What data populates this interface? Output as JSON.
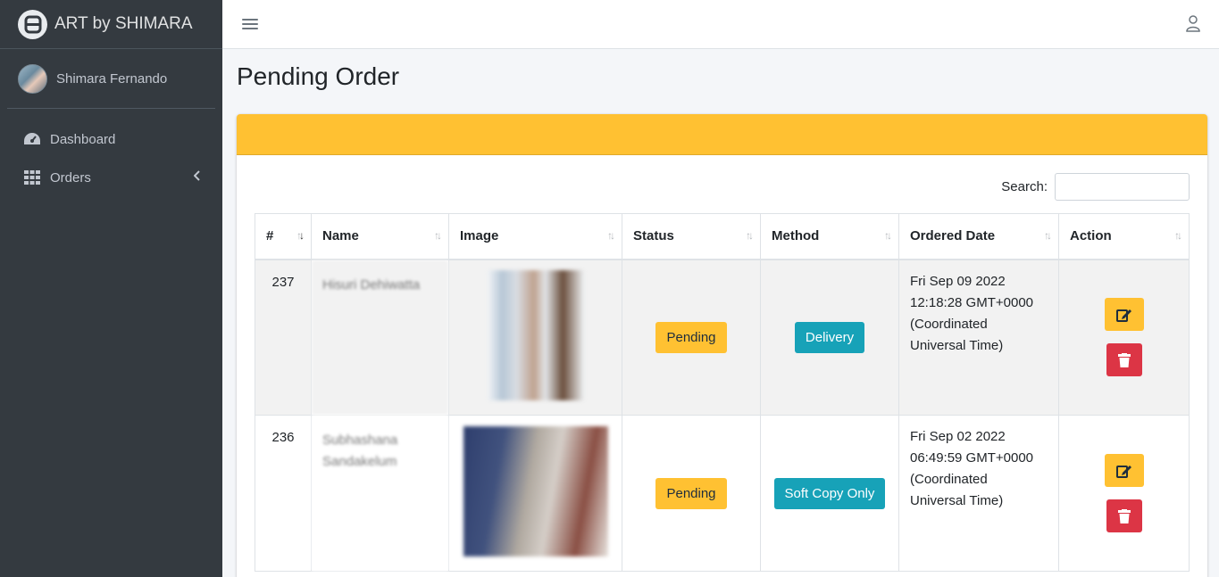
{
  "brand": {
    "name": "ART by SHIMARA"
  },
  "user": {
    "name": "Shimara Fernando"
  },
  "nav": {
    "items": [
      {
        "label": "Dashboard",
        "icon": "dashboard-icon"
      },
      {
        "label": "Orders",
        "icon": "grid-icon"
      }
    ]
  },
  "page": {
    "title": "Pending Order"
  },
  "search": {
    "label": "Search:",
    "value": ""
  },
  "table": {
    "columns": [
      "#",
      "Name",
      "Image",
      "Status",
      "Method",
      "Ordered Date",
      "Action"
    ],
    "rows": [
      {
        "id": "237",
        "name": "Hisuri Dehiwatta",
        "status": "Pending",
        "method": "Delivery",
        "date_line1": "Fri Sep 09 2022",
        "date_line2": "12:18:28 GMT+0000",
        "date_line3": "(Coordinated",
        "date_line4": "Universal Time)"
      },
      {
        "id": "236",
        "name": "Subhashana Sandakelum",
        "status": "Pending",
        "method": "Soft Copy Only",
        "date_line1": "Fri Sep 02 2022",
        "date_line2": "06:49:59 GMT+0000",
        "date_line3": "(Coordinated",
        "date_line4": "Universal Time)"
      }
    ]
  },
  "colors": {
    "sidebar": "#343a40",
    "accent": "#ffc132",
    "info": "#17a2b8",
    "danger": "#dc3545"
  }
}
